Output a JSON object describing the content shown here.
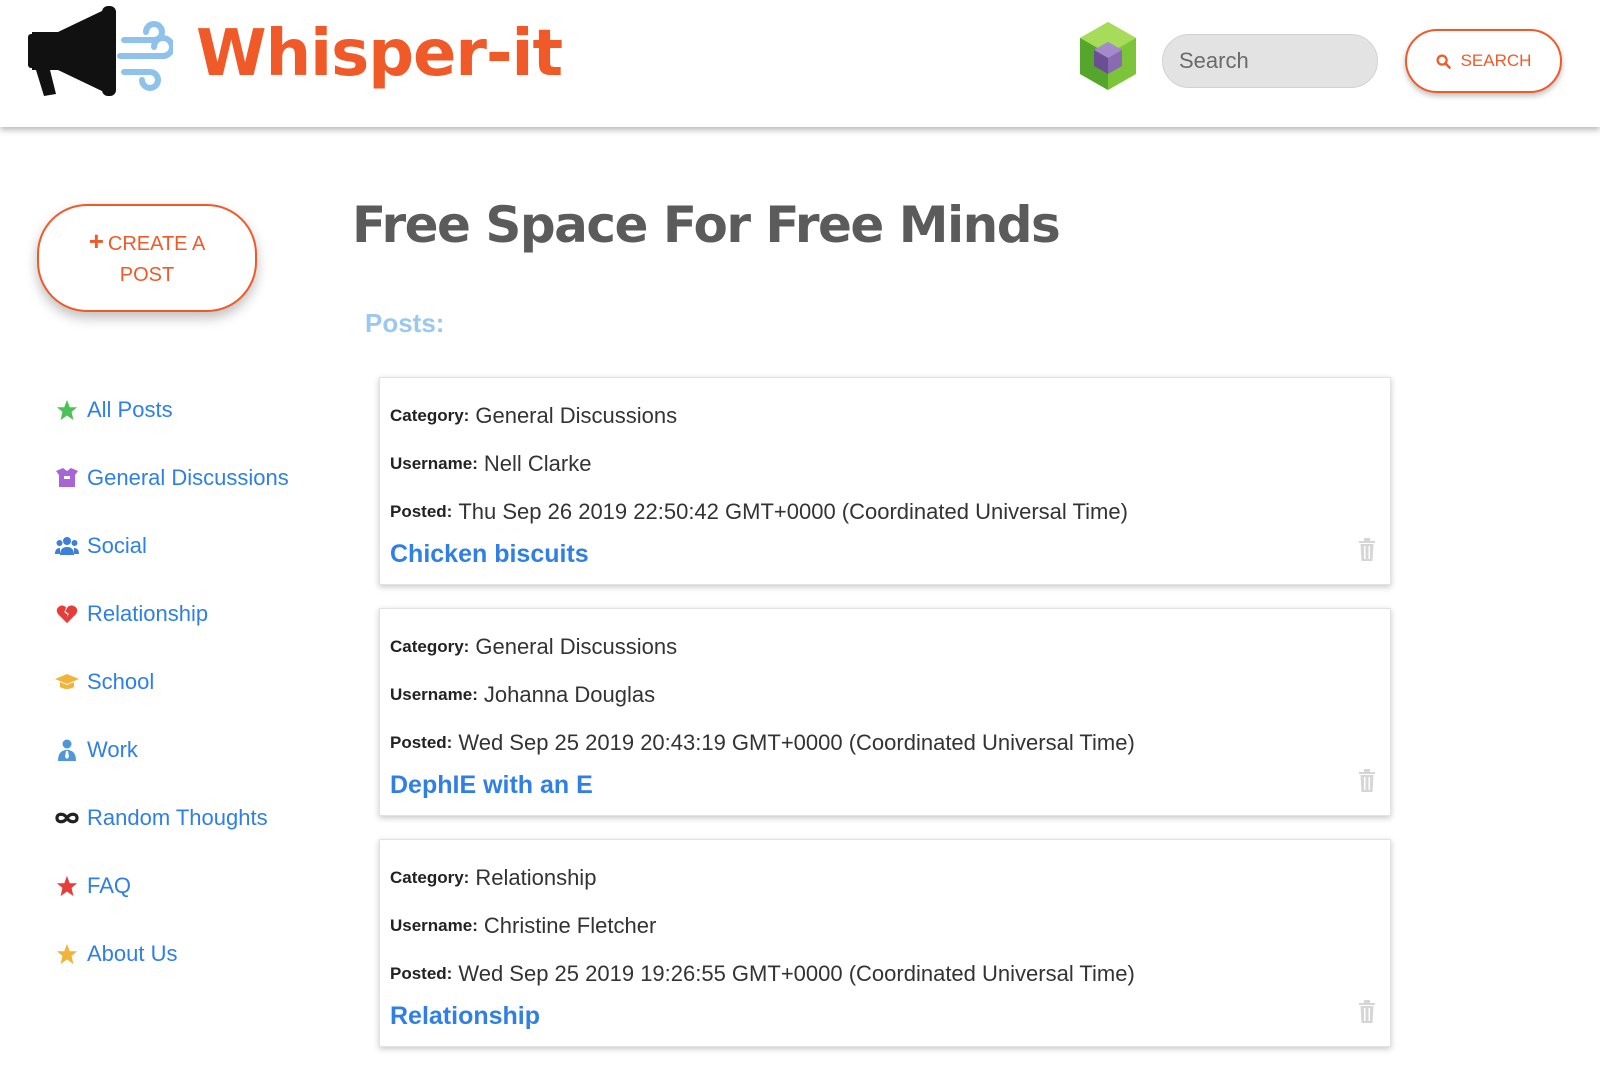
{
  "header": {
    "brand": "Whisper-it",
    "logo_icon": "megaphone-wind-icon",
    "badge_icon": "green-cube-icon",
    "search": {
      "placeholder": "Search",
      "value": ""
    },
    "search_button": {
      "label": "SEARCH",
      "icon": "search-icon"
    }
  },
  "colors": {
    "accent": "#f05a28",
    "link": "#2f7fe6",
    "posts_label": "#9bc8ee",
    "title": "#5b5b5b"
  },
  "sidebar": {
    "create_button": {
      "label": "CREATE A POST",
      "icon": "plus-icon"
    },
    "items": [
      {
        "label": "All Posts",
        "icon": "star-icon",
        "icon_color": "#4cc256"
      },
      {
        "label": "General Discussions",
        "icon": "box-icon",
        "icon_color": "#a864d4"
      },
      {
        "label": "Social",
        "icon": "users-icon",
        "icon_color": "#3d7fd9"
      },
      {
        "label": "Relationship",
        "icon": "heart-broken-icon",
        "icon_color": "#e63c3c"
      },
      {
        "label": "School",
        "icon": "graduation-cap-icon",
        "icon_color": "#f1b43a"
      },
      {
        "label": "Work",
        "icon": "user-tie-icon",
        "icon_color": "#4f97d8"
      },
      {
        "label": "Random Thoughts",
        "icon": "infinity-icon",
        "icon_color": "#222222"
      },
      {
        "label": "FAQ",
        "icon": "star-icon",
        "icon_color": "#e63c3c"
      },
      {
        "label": "About Us",
        "icon": "star-icon",
        "icon_color": "#f1b43a"
      }
    ]
  },
  "main": {
    "title": "Free Space For Free Minds",
    "posts_label": "Posts:",
    "field_labels": {
      "category": "Category:",
      "username": "Username:",
      "posted": "Posted:"
    },
    "posts": [
      {
        "category": "General Discussions",
        "username": "Nell Clarke",
        "posted": "Thu Sep 26 2019 22:50:42 GMT+0000 (Coordinated Universal Time)",
        "title": "Chicken biscuits"
      },
      {
        "category": "General Discussions",
        "username": "Johanna Douglas",
        "posted": "Wed Sep 25 2019 20:43:19 GMT+0000 (Coordinated Universal Time)",
        "title": "DephIE with an E"
      },
      {
        "category": "Relationship",
        "username": "Christine Fletcher",
        "posted": "Wed Sep 25 2019 19:26:55 GMT+0000 (Coordinated Universal Time)",
        "title": "Relationship"
      }
    ]
  }
}
